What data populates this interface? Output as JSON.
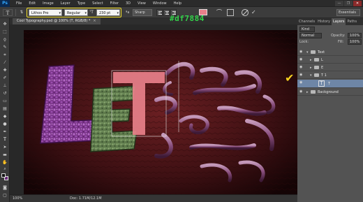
{
  "app": {
    "logo": "Ps"
  },
  "menu": [
    "File",
    "Edit",
    "Image",
    "Layer",
    "Type",
    "Select",
    "Filter",
    "3D",
    "View",
    "Window",
    "Help"
  ],
  "window_controls": [
    "—",
    "❐",
    "✕"
  ],
  "options": {
    "font_family": "Lithos Pro",
    "font_style": "Regular",
    "font_size": "230 pt",
    "aa_label": "ªa",
    "antialias": "Sharp",
    "text_color": "#e8808a",
    "workspace": "Essentials"
  },
  "document": {
    "tab_title": "Cool Typography.psd @ 100% (T, RGB/8) *",
    "close_glyph": "×"
  },
  "annotation": {
    "hex_text": "#df7884",
    "color": "#33d14a"
  },
  "status": {
    "zoom": "100%",
    "doc": "Doc: 1.71M/12.1M"
  },
  "panels": {
    "tabs": [
      "Channels",
      "History",
      "Layers",
      "Paths"
    ],
    "active_tab": "Layers",
    "kind_label": "Kind",
    "blend_mode": "Normal",
    "opacity_label": "Opacity:",
    "opacity": "100%",
    "lock_label": "Lock:",
    "fill_label": "Fill:",
    "fill": "100%",
    "layers": [
      {
        "name": "Text",
        "type": "group",
        "indent": 0,
        "expanded": true
      },
      {
        "name": "L",
        "type": "group",
        "indent": 1,
        "expanded": false
      },
      {
        "name": "E",
        "type": "group",
        "indent": 1,
        "expanded": false
      },
      {
        "name": "T 1",
        "type": "group",
        "indent": 1,
        "expanded": true
      },
      {
        "name": "T",
        "type": "text",
        "indent": 2,
        "selected": true
      },
      {
        "name": "Background",
        "type": "group",
        "indent": 0,
        "expanded": false
      }
    ]
  },
  "colors": {
    "accent_yellow": "#f5e02a",
    "bg_dark_red": "#3a1214",
    "letter_L": "#8a3e92",
    "letter_E": "#5a7a4a",
    "letter_T": "#e8808a"
  }
}
